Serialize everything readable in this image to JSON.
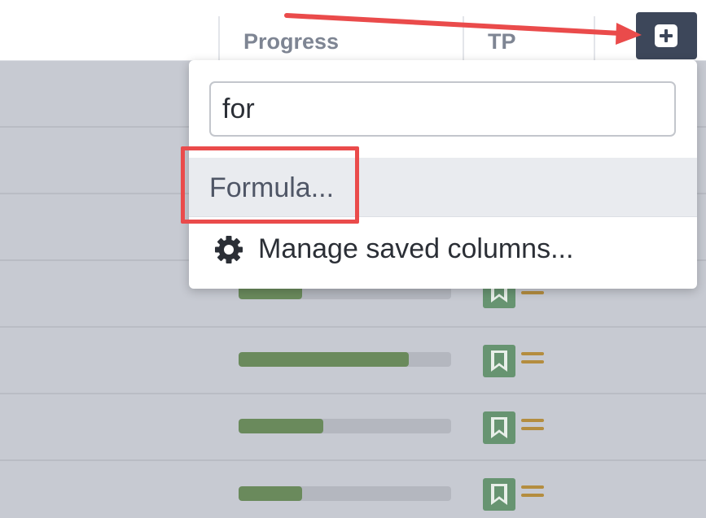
{
  "header": {
    "columns": [
      {
        "label": "Progress"
      },
      {
        "label": "TP"
      }
    ],
    "add_column_icon": "plus-square-icon"
  },
  "rows": [
    {
      "progress": 0.3,
      "type_icon": "story-icon",
      "priority_icon": "medium-priority-icon"
    },
    {
      "progress": 0.8,
      "type_icon": "story-icon",
      "priority_icon": "medium-priority-icon"
    },
    {
      "progress": 0.4,
      "type_icon": "story-icon",
      "priority_icon": "medium-priority-icon"
    },
    {
      "progress": 0.3,
      "type_icon": "story-icon",
      "priority_icon": "medium-priority-icon"
    }
  ],
  "dropdown": {
    "search_value": "for",
    "items": [
      {
        "label": "Formula..."
      },
      {
        "label": "Manage saved columns...",
        "icon": "gear-icon"
      }
    ]
  },
  "annotations": {
    "color": "#ea4b4b"
  },
  "colors": {
    "progress_fill": "#6a8a5c",
    "story_icon": "#679471",
    "priority": "#b48d3f",
    "add_button": "#3d475a"
  }
}
